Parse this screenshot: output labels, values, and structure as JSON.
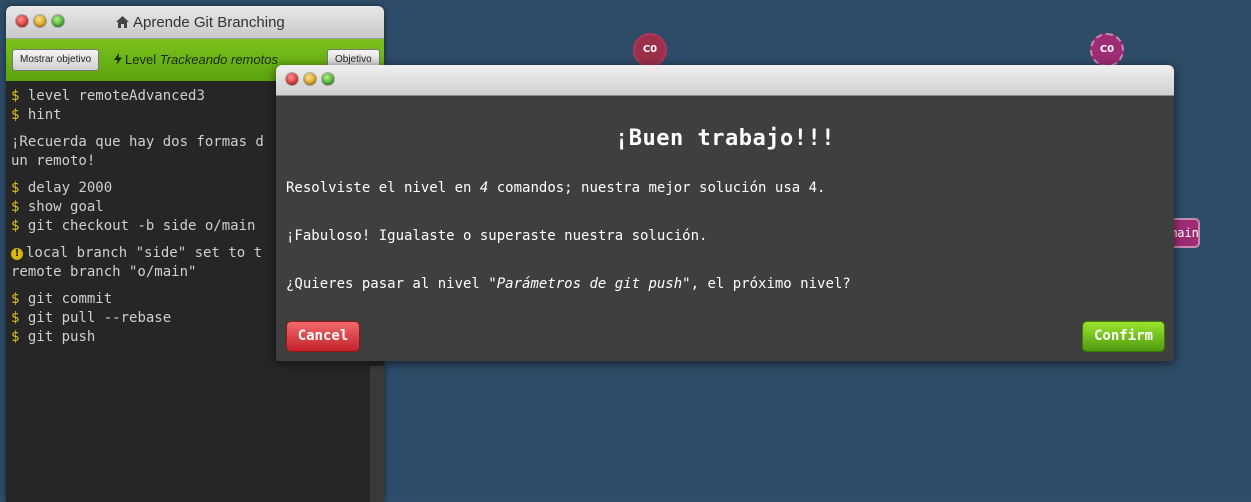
{
  "terminal": {
    "window_title": "Aprende Git Branching",
    "toolbar": {
      "show_goal_label": "Mostrar objetivo",
      "level_prefix": "Level",
      "level_name": "Trackeando remotos",
      "objective_label": "Objetivo"
    },
    "lines": {
      "l1": "level remoteAdvanced3",
      "l2": "hint",
      "l3": "¡Recuerda que hay dos formas d",
      "l4": "un remoto!",
      "l5": "delay 2000",
      "l6": "show goal",
      "l7": "git checkout -b side o/main",
      "l8": "local branch \"side\" set to t",
      "l9": "remote branch \"o/main\"",
      "l10": "git commit",
      "l11": "git pull --rebase",
      "l12": "git push"
    },
    "prompt_symbol": "$"
  },
  "visualization": {
    "local_commit": "C0",
    "remote_commit": "C0",
    "branch_tag": "main"
  },
  "dialog": {
    "heading": "¡Buen trabajo!!!",
    "p1_before": "Resolviste el nivel en ",
    "p1_count": "4",
    "p1_after": " comandos; nuestra mejor solución usa 4.",
    "p2": "¡Fabuloso! Igualaste o superaste nuestra solución.",
    "p3_before": "¿Quieres pasar al nivel ",
    "p3_level": "\"Parámetros de git push\"",
    "p3_after": ", el próximo nivel?",
    "cancel_label": "Cancel",
    "confirm_label": "Confirm"
  },
  "colors": {
    "background": "#2e4c68",
    "toolbar_green": "#6bb31a",
    "prompt_yellow": "#e0c21a",
    "commit_red": "#9c2f4a",
    "commit_magenta": "#9d2c75"
  }
}
